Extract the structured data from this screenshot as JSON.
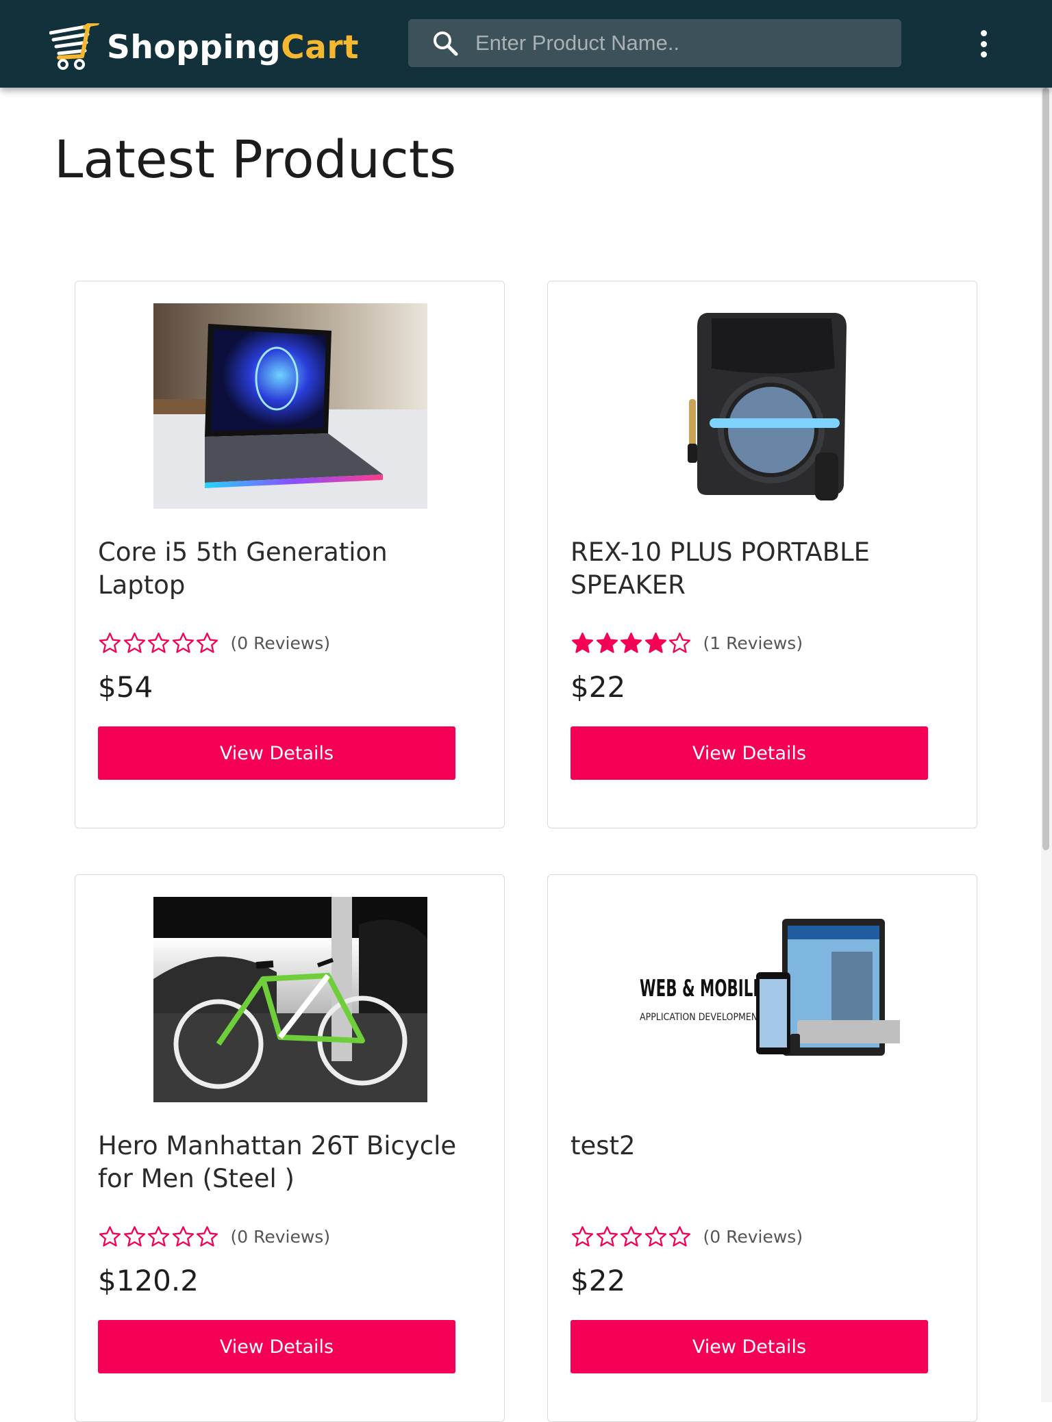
{
  "header": {
    "logo_shopping": "Shopping",
    "logo_cart": "Cart",
    "search_placeholder": "Enter Product Name..",
    "brand_bg": "#13313b",
    "logo_accent": "#f5b82e"
  },
  "page_title": "Latest Products",
  "accent_color": "#f50057",
  "products": [
    {
      "name": "Core i5 5th Generation Laptop",
      "rating": 0,
      "reviews": "(0 Reviews)",
      "price": "$54",
      "button": "View Details",
      "image_icon": "laptop-image"
    },
    {
      "name": "REX-10 PLUS PORTABLE SPEAKER",
      "rating": 4,
      "reviews": "(1 Reviews)",
      "price": "$22",
      "button": "View Details",
      "image_icon": "speaker-image"
    },
    {
      "name": "Hero Manhattan 26T Bicycle for Men (Steel )",
      "rating": 0,
      "reviews": "(0 Reviews)",
      "price": "$120.2",
      "button": "View Details",
      "image_icon": "bicycle-image"
    },
    {
      "name": "test2",
      "rating": 0,
      "reviews": "(0 Reviews)",
      "price": "$22",
      "button": "View Details",
      "image_icon": "web-mobile-image",
      "image_text_1": "WEB & MOBILE",
      "image_text_2": "APPLICATION DEVELOPMENT"
    }
  ]
}
